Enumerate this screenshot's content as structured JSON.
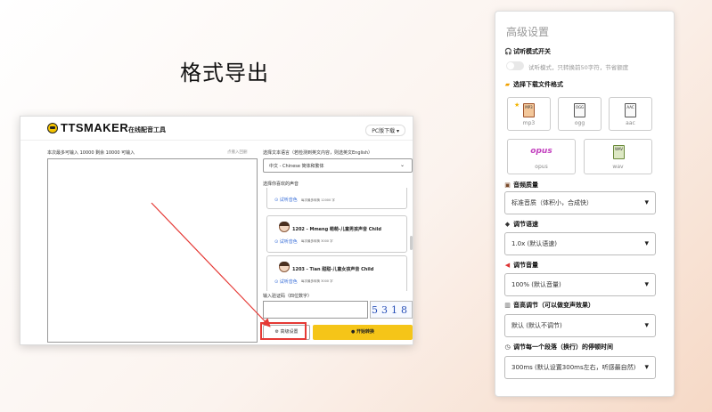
{
  "heading": "格式导出",
  "tts": {
    "brand": "TTSMAKER",
    "brand_sub": "在线配音工具",
    "pc_download": "PC版下载",
    "counter": "本次最多可输入 10000 剩余 10000 可输入",
    "undo": "点撤入回删",
    "lang_label": "选择文本语言（若检测到英文内容，则选英文English）",
    "lang_value": "中文 - Chinese 简体和繁体",
    "voice_label": "选择你喜欢的声音",
    "voices": [
      {
        "name": "",
        "trial": "试听音色",
        "meta": "每次最多转换 12000 字"
      },
      {
        "name": "1202 - Mmeng 萌萌-儿童男孩声音 Child",
        "trial": "试听音色",
        "meta": "每次最多转换 3000 字"
      },
      {
        "name": "1203 - Tian 甜甜-儿童女孩声音 Child",
        "trial": "试听音色",
        "meta": "每次最多转换 3000 字"
      }
    ],
    "code_label": "输入验证码（四位数字）",
    "captcha": "5318",
    "adv_button": "高级设置",
    "convert_button": "开始转换"
  },
  "panel": {
    "title": "高级设置",
    "listen_mode": {
      "title": "试听模式开关",
      "text": "试听模式，只转换前50字符，节省额度",
      "on": false
    },
    "format": {
      "title": "选择下载文件格式",
      "options": [
        {
          "label": "mp3",
          "icon": "MP3",
          "selected": true
        },
        {
          "label": "ogg",
          "icon": "OGG",
          "selected": false
        },
        {
          "label": "aac",
          "icon": "AAC",
          "selected": false
        },
        {
          "label": "opus",
          "icon": "opus",
          "selected": false
        },
        {
          "label": "wav",
          "icon": "WAV",
          "selected": false
        }
      ]
    },
    "quality": {
      "title": "音频质量",
      "value": "标准音质（体积小，合成快）"
    },
    "speed": {
      "title": "调节语速",
      "value": "1.0x (默认语速)"
    },
    "volume": {
      "title": "调节音量",
      "value": "100% (默认音量)"
    },
    "pitch": {
      "title": "音高调节（可以做变声效果）",
      "value": "默认 (默认不调节)"
    },
    "pause": {
      "title": "调节每一个段落（换行）的停顿时间",
      "value": "300ms (默认设置300ms左右，听感最自然)"
    }
  },
  "colors": {
    "accent": "#f5c518",
    "arrow": "#e53935",
    "link": "#3a6fd8"
  }
}
